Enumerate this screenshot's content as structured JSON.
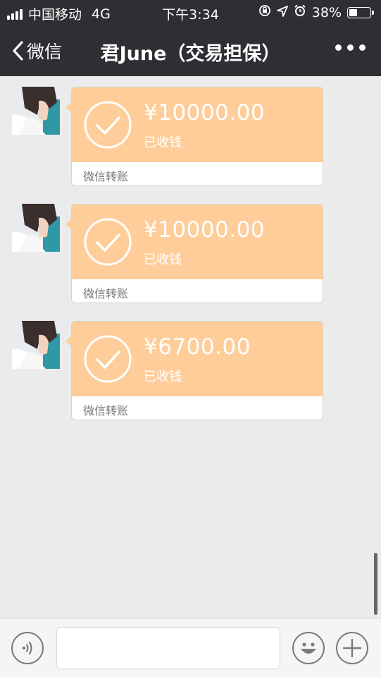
{
  "status_bar": {
    "carrier": "中国移动",
    "network": "4G",
    "time": "下午3:34",
    "battery_text": "38%",
    "battery_level": 0.38
  },
  "nav": {
    "back_label": "微信",
    "title": "君June（交易担保）"
  },
  "messages": [
    {
      "amount": "¥10000.00",
      "status": "已收钱",
      "footer": "微信转账"
    },
    {
      "amount": "¥10000.00",
      "status": "已收钱",
      "footer": "微信转账"
    },
    {
      "amount": "¥6700.00",
      "status": "已收钱",
      "footer": "微信转账"
    }
  ],
  "input": {
    "placeholder": ""
  },
  "icons": {
    "voice": "voice-icon",
    "emoji": "emoji-icon",
    "add": "plus-icon",
    "check": "check-circle-icon"
  },
  "colors": {
    "header_bg": "#2e2e33",
    "transfer_bubble": "#ffcd99",
    "chat_bg": "#ebebeb"
  }
}
